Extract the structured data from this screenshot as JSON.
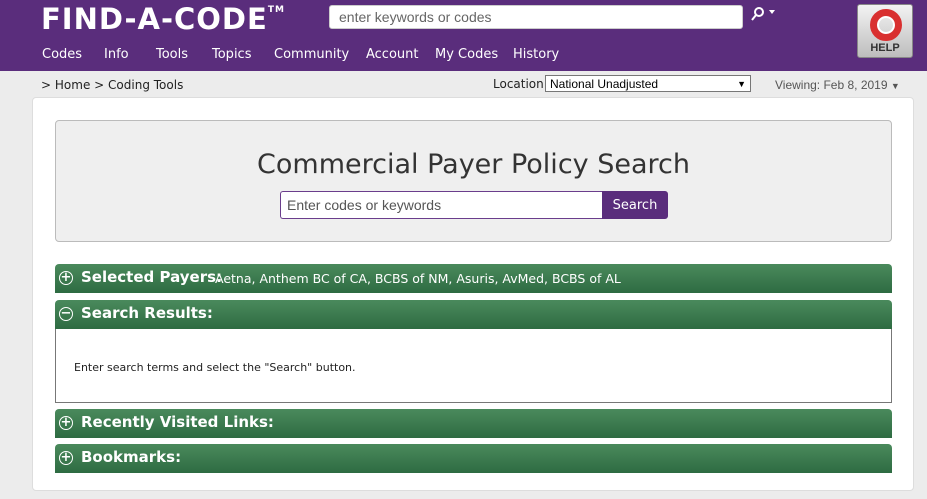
{
  "header": {
    "logo_text": "FIND-A-CODE",
    "logo_tm": "TM",
    "search_placeholder": "enter keywords or codes",
    "help_label": "HELP"
  },
  "nav": {
    "items": [
      {
        "label": "Codes"
      },
      {
        "label": "Info"
      },
      {
        "label": "Tools"
      },
      {
        "label": "Topics"
      },
      {
        "label": "Community"
      },
      {
        "label": "Account"
      },
      {
        "label": "My Codes"
      },
      {
        "label": "History"
      }
    ]
  },
  "breadcrumb": {
    "sep1": ">",
    "home": "Home",
    "sep2": ">",
    "current": "Coding Tools"
  },
  "location": {
    "label": "Location:",
    "selected": "National Unadjusted"
  },
  "viewing": {
    "text": "Viewing: Feb 8, 2019",
    "arrow": "▼"
  },
  "hero": {
    "title": "Commercial Payer Policy Search",
    "input_placeholder": "Enter codes or keywords",
    "button_label": "Search"
  },
  "sections": {
    "selected_payers": {
      "title": "Selected Payers:",
      "value": "Aetna, Anthem BC of CA, BCBS of NM, Asuris, AvMed, BCBS of AL",
      "icon": "plus-circle-icon"
    },
    "search_results": {
      "title": "Search Results:",
      "body": "Enter search terms and select the \"Search\" button.",
      "icon": "minus-circle-icon"
    },
    "recent_links": {
      "title": "Recently Visited Links:",
      "icon": "plus-circle-icon"
    },
    "bookmarks": {
      "title": "Bookmarks:",
      "icon": "plus-circle-icon"
    }
  },
  "colors": {
    "brand_purple": "#5a2d7c",
    "section_green": "#2e6b42"
  }
}
